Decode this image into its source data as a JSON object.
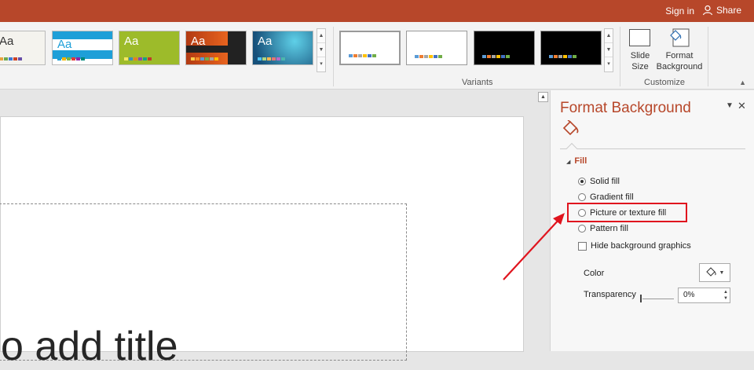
{
  "titlebar": {
    "signin": "Sign in",
    "share": "Share",
    "bg": "#b7472a"
  },
  "themes": [
    {
      "sample": "Aa",
      "bg": "#f4f3ee",
      "text": "#333333"
    },
    {
      "sample": "Aa",
      "bg": "#1e9fd8",
      "text": "#1e9fd8"
    },
    {
      "sample": "Aa",
      "bg": "#9dbb2a",
      "text": "#ffffff"
    },
    {
      "sample": "Aa",
      "bg": "#d24a1a",
      "text": "#ffffff"
    },
    {
      "sample": "Aa",
      "bg": "#2fa7c4",
      "text": "#ffffff"
    }
  ],
  "variants": {
    "label": "Variants"
  },
  "customize": {
    "label": "Customize",
    "slide_size": "Slide Size",
    "format_background": "Format Background"
  },
  "pane": {
    "title": "Format Background",
    "section": "Fill",
    "options": {
      "solid": "Solid fill",
      "gradient": "Gradient fill",
      "picture": "Picture or texture fill",
      "pattern": "Pattern fill"
    },
    "hide_graphics": "Hide background graphics",
    "color_label": "Color",
    "transparency_label": "Transparency",
    "transparency_value": "0%",
    "transparency_level": 0
  },
  "slide": {
    "title_fragment": "o add title"
  },
  "colors": {
    "accent": "#b7472a",
    "annotation": "#e0141e"
  }
}
